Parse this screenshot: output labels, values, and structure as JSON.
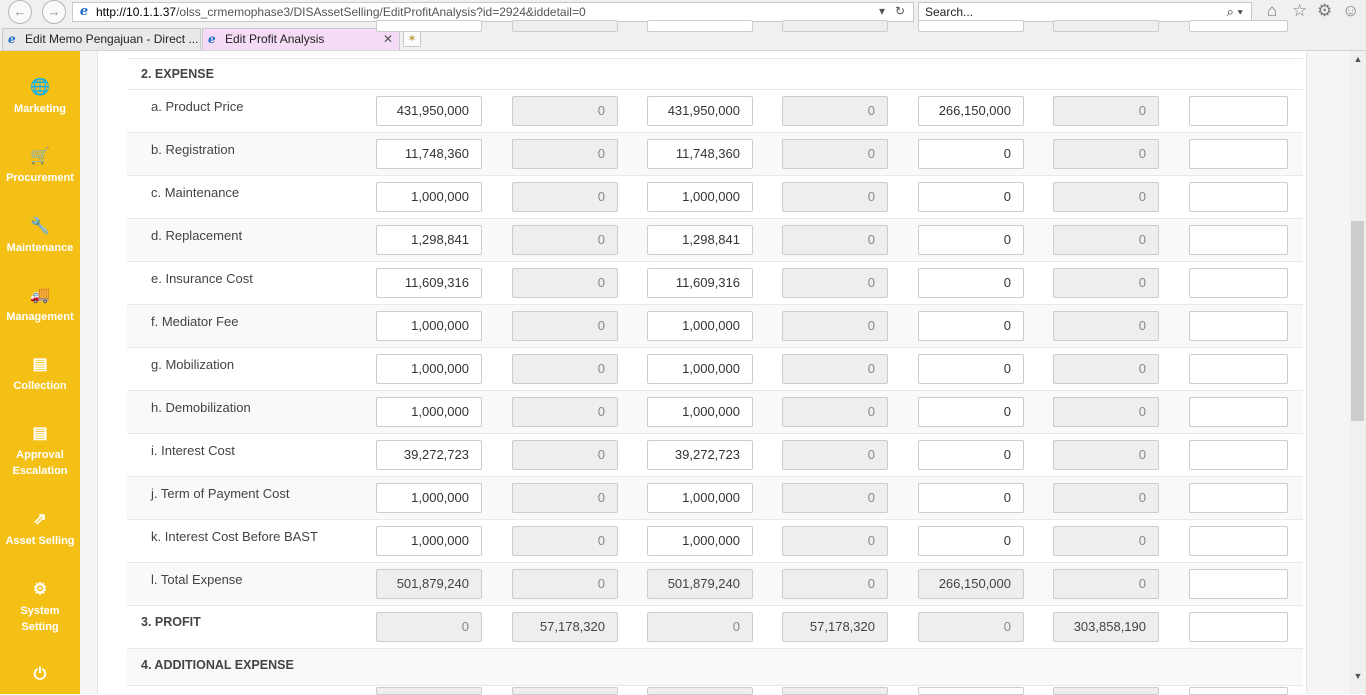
{
  "browser": {
    "back": "←",
    "forward": "→",
    "url_host": "http://10.1.1.37",
    "url_path": "/olss_crmemophase3/DISAssetSelling/EditProfitAnalysis?id=2924&iddetail=0",
    "search_placeholder": "Search...",
    "tabs": [
      {
        "label": "Edit Memo Pengajuan - Direct ...",
        "active": false
      },
      {
        "label": "Edit Profit Analysis",
        "active": true,
        "close": "✕"
      }
    ]
  },
  "sidebar": {
    "items": [
      {
        "label": "Marketing",
        "icon": "globe-icon",
        "glyph": "🌐"
      },
      {
        "label": "Procurement",
        "icon": "cart-icon",
        "glyph": "🛒"
      },
      {
        "label": "Maintenance",
        "icon": "wrench-icon",
        "glyph": "🔧"
      },
      {
        "label": "Management",
        "icon": "truck-icon",
        "glyph": "🚚"
      },
      {
        "label": "Collection",
        "icon": "list-icon",
        "glyph": "▤"
      },
      {
        "label": "Approval Escalation",
        "icon": "list-icon",
        "glyph": "▤"
      },
      {
        "label": "Asset Selling",
        "icon": "external-link-icon",
        "glyph": "⇗"
      },
      {
        "label": "System Setting",
        "icon": "gear-icon",
        "glyph": "⚙"
      },
      {
        "label": "",
        "icon": "power-icon",
        "glyph": "⏻"
      }
    ]
  },
  "table": {
    "sections": {
      "expense": "2. EXPENSE",
      "profit": "3. PROFIT",
      "additional": "4. ADDITIONAL EXPENSE"
    },
    "expense_rows": [
      {
        "label": "a. Product Price",
        "values": [
          "431,950,000",
          "0",
          "431,950,000",
          "0",
          "266,150,000",
          "0",
          ""
        ]
      },
      {
        "label": "b. Registration",
        "values": [
          "11,748,360",
          "0",
          "11,748,360",
          "0",
          "0",
          "0",
          ""
        ]
      },
      {
        "label": "c. Maintenance",
        "values": [
          "1,000,000",
          "0",
          "1,000,000",
          "0",
          "0",
          "0",
          ""
        ]
      },
      {
        "label": "d. Replacement",
        "values": [
          "1,298,841",
          "0",
          "1,298,841",
          "0",
          "0",
          "0",
          ""
        ]
      },
      {
        "label": "e. Insurance Cost",
        "values": [
          "11,609,316",
          "0",
          "11,609,316",
          "0",
          "0",
          "0",
          ""
        ]
      },
      {
        "label": "f. Mediator Fee",
        "values": [
          "1,000,000",
          "0",
          "1,000,000",
          "0",
          "0",
          "0",
          ""
        ]
      },
      {
        "label": "g. Mobilization",
        "values": [
          "1,000,000",
          "0",
          "1,000,000",
          "0",
          "0",
          "0",
          ""
        ]
      },
      {
        "label": "h. Demobilization",
        "values": [
          "1,000,000",
          "0",
          "1,000,000",
          "0",
          "0",
          "0",
          ""
        ]
      },
      {
        "label": "i. Interest Cost",
        "values": [
          "39,272,723",
          "0",
          "39,272,723",
          "0",
          "0",
          "0",
          ""
        ]
      },
      {
        "label": "j. Term of Payment Cost",
        "values": [
          "1,000,000",
          "0",
          "1,000,000",
          "0",
          "0",
          "0",
          ""
        ]
      },
      {
        "label": "k. Interest Cost Before BAST",
        "values": [
          "1,000,000",
          "0",
          "1,000,000",
          "0",
          "0",
          "0",
          ""
        ]
      },
      {
        "label": "l. Total Expense",
        "values": [
          "501,879,240",
          "0",
          "501,879,240",
          "0",
          "266,150,000",
          "0",
          ""
        ]
      }
    ],
    "profit_values": [
      "0",
      "57,178,320",
      "0",
      "57,178,320",
      "0",
      "303,858,190",
      ""
    ]
  }
}
